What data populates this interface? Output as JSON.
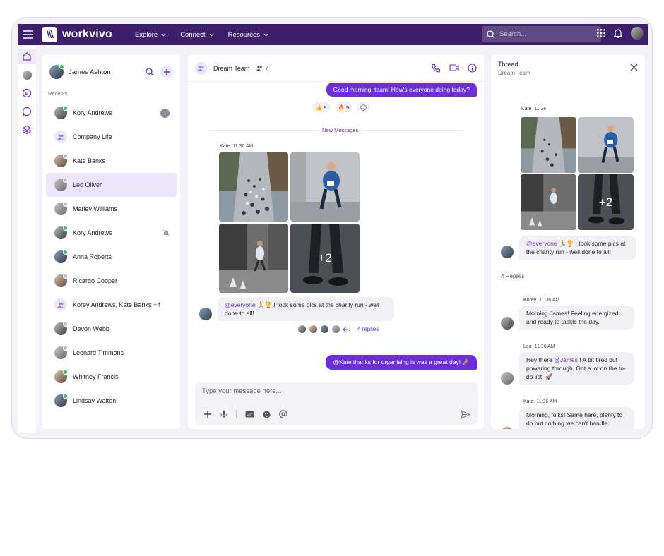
{
  "brand": {
    "name": "workvivo",
    "mark": "\\\\\\",
    "primary": "#3d1f6b",
    "accent": "#6b2fd6"
  },
  "nav": [
    {
      "label": "Explore"
    },
    {
      "label": "Connect"
    },
    {
      "label": "Resources"
    }
  ],
  "search": {
    "placeholder": "Search..."
  },
  "user": {
    "name": "James Ashton"
  },
  "sidebar": {
    "section": "Recents",
    "items": [
      {
        "label": "Kory Andrews",
        "status": "online",
        "badge": "1"
      },
      {
        "label": "Company Life",
        "type": "group"
      },
      {
        "label": "Kate Banks",
        "status": "away"
      },
      {
        "label": "Leo Oliver",
        "status": "away",
        "selected": true
      },
      {
        "label": "Marley Williams",
        "status": "away"
      },
      {
        "label": "Kory Andrews",
        "status": "online",
        "muted": true
      },
      {
        "label": "Anna Roberts",
        "status": "online"
      },
      {
        "label": "Ricardo Cooper",
        "status": "away"
      },
      {
        "label": "Korey Andrews, Kate Banks +4",
        "type": "group"
      },
      {
        "label": "Devon Webb",
        "status": "away"
      },
      {
        "label": "Leonard Timmons",
        "status": "away"
      },
      {
        "label": "Whitney Francis",
        "status": "online"
      },
      {
        "label": "Lindsay Walton",
        "status": "online"
      }
    ]
  },
  "chat": {
    "title": "Dream Team",
    "members": "7",
    "msg1": "Good morning, team! How's everyone doing today?",
    "reactions": [
      {
        "emoji": "👍",
        "count": "9"
      },
      {
        "emoji": "🔥",
        "count": "9"
      }
    ],
    "new_messages": "New Messages",
    "kate_name": "Kate",
    "kate_time": "11:36 AM",
    "more_photos": "+2",
    "mention": "@everyone",
    "kate_emoji": "🏃🏆",
    "kate_text": " I took some pics at the charity run - well done to all!",
    "replies": "4 replies",
    "msg_out2": "@Kate thanks for organising is was a great day! 🚀",
    "composer_placeholder": "Type your message here..."
  },
  "thread": {
    "title": "Thread",
    "subtitle": "Dream Team",
    "kate_name": "Kate",
    "kate_time": "11:36",
    "more_photos": "+2",
    "mention": "@everyone",
    "kate_emoji": "🏃🏆",
    "kate_text": " I took some pics at the charity run - well done to all!",
    "replies_count": "4 Replies",
    "r1_name": "Korey",
    "r1_time": "11:36 AM",
    "r1_text": "Morning James! Feeling energized and ready to tackle the day.",
    "r2_name": "Leo",
    "r2_time": "11:36 AM",
    "r2_pre": "Hey there ",
    "r2_mention": "@James",
    "r2_post": " ! A bit tired but powering through. Got a lot on the to-do list. 🚀",
    "r3_name": "Kate",
    "r3_time": "11:36 AM",
    "r3_text": "Morning, folks! Same here, plenty to do but nothing we can't handle together."
  }
}
